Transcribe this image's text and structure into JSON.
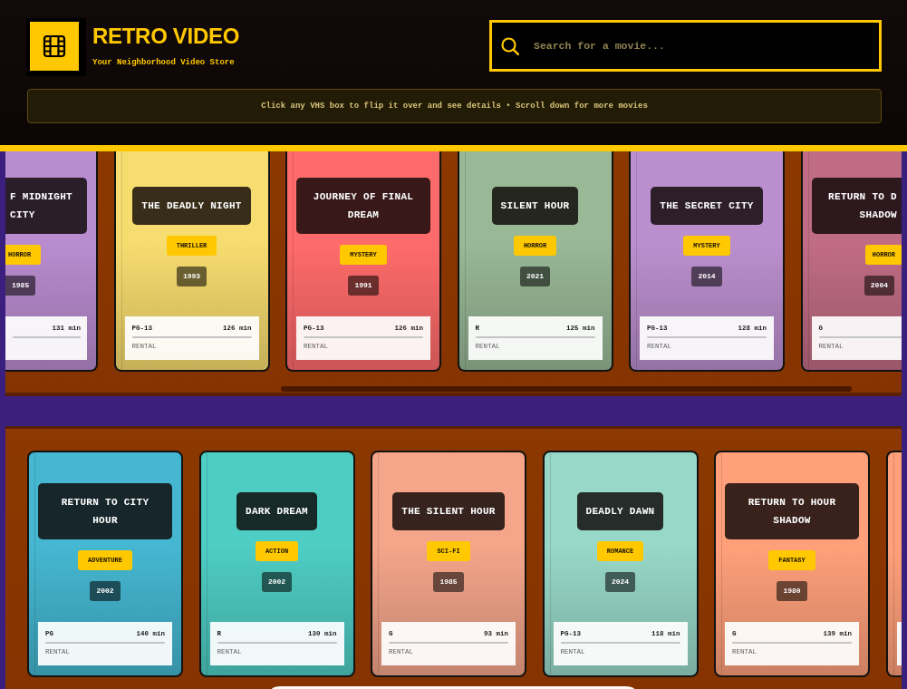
{
  "header": {
    "store_name": "RETRO VIDEO",
    "tagline": "Your Neighborhood Video Store",
    "search": {
      "placeholder": "Search for a movie..."
    },
    "hint": "Click any VHS box to flip it over and see details • Scroll down for more movies"
  },
  "shelves": [
    {
      "scrollbar": true,
      "movies": [
        {
          "kind": "cut-left",
          "color": "#b98ccf",
          "title": "F MIDNIGHT CITY",
          "genre": "HORROR",
          "year": "1985",
          "runtime": "131 min"
        },
        {
          "kind": "full",
          "color": "#f7dc6f",
          "title": "THE DEADLY NIGHT",
          "genre": "THRILLER",
          "year": "1993",
          "rating": "PG-13",
          "runtime": "126 min",
          "status": "RENTAL"
        },
        {
          "kind": "full",
          "color": "#ff6b6b",
          "title": "JOURNEY OF FINAL DREAM",
          "genre": "MYSTERY",
          "year": "1991",
          "rating": "PG-13",
          "runtime": "126 min",
          "status": "RENTAL"
        },
        {
          "kind": "full",
          "color": "#98b896",
          "title": "SILENT HOUR",
          "genre": "HORROR",
          "year": "2021",
          "rating": "R",
          "runtime": "125 min",
          "status": "RENTAL"
        },
        {
          "kind": "full",
          "color": "#bb8fce",
          "title": "THE SECRET CITY",
          "genre": "MYSTERY",
          "year": "2014",
          "rating": "PG-13",
          "runtime": "128 min",
          "status": "RENTAL"
        },
        {
          "kind": "cut-right",
          "color": "#c06c84",
          "title": "RETURN TO D SHADOW",
          "genre": "HORROR",
          "year": "2004",
          "rating": "G",
          "status": "RENTAL"
        }
      ]
    },
    {
      "scrollbar": false,
      "movies": [
        {
          "kind": "full",
          "color": "#45b7d1",
          "title": "RETURN TO CITY HOUR",
          "genre": "ADVENTURE",
          "year": "2002",
          "rating": "PG",
          "runtime": "140 min",
          "status": "RENTAL"
        },
        {
          "kind": "full",
          "color": "#4ecdc4",
          "title": "DARK DREAM",
          "genre": "ACTION",
          "year": "2002",
          "rating": "R",
          "runtime": "130 min",
          "status": "RENTAL"
        },
        {
          "kind": "full",
          "color": "#f4a58a",
          "title": "THE SILENT HOUR",
          "genre": "SCI-FI",
          "year": "1985",
          "rating": "G",
          "runtime": "93 min",
          "status": "RENTAL"
        },
        {
          "kind": "full",
          "color": "#98d8c8",
          "title": "DEADLY DAWN",
          "genre": "ROMANCE",
          "year": "2024",
          "rating": "PG-13",
          "runtime": "118 min",
          "status": "RENTAL"
        },
        {
          "kind": "full",
          "color": "#ffa07a",
          "title": "RETURN TO HOUR SHADOW",
          "genre": "FANTASY",
          "year": "1980",
          "rating": "G",
          "runtime": "139 min",
          "status": "RENTAL"
        },
        {
          "kind": "cut-right",
          "color": "#ffa07a"
        }
      ]
    }
  ]
}
